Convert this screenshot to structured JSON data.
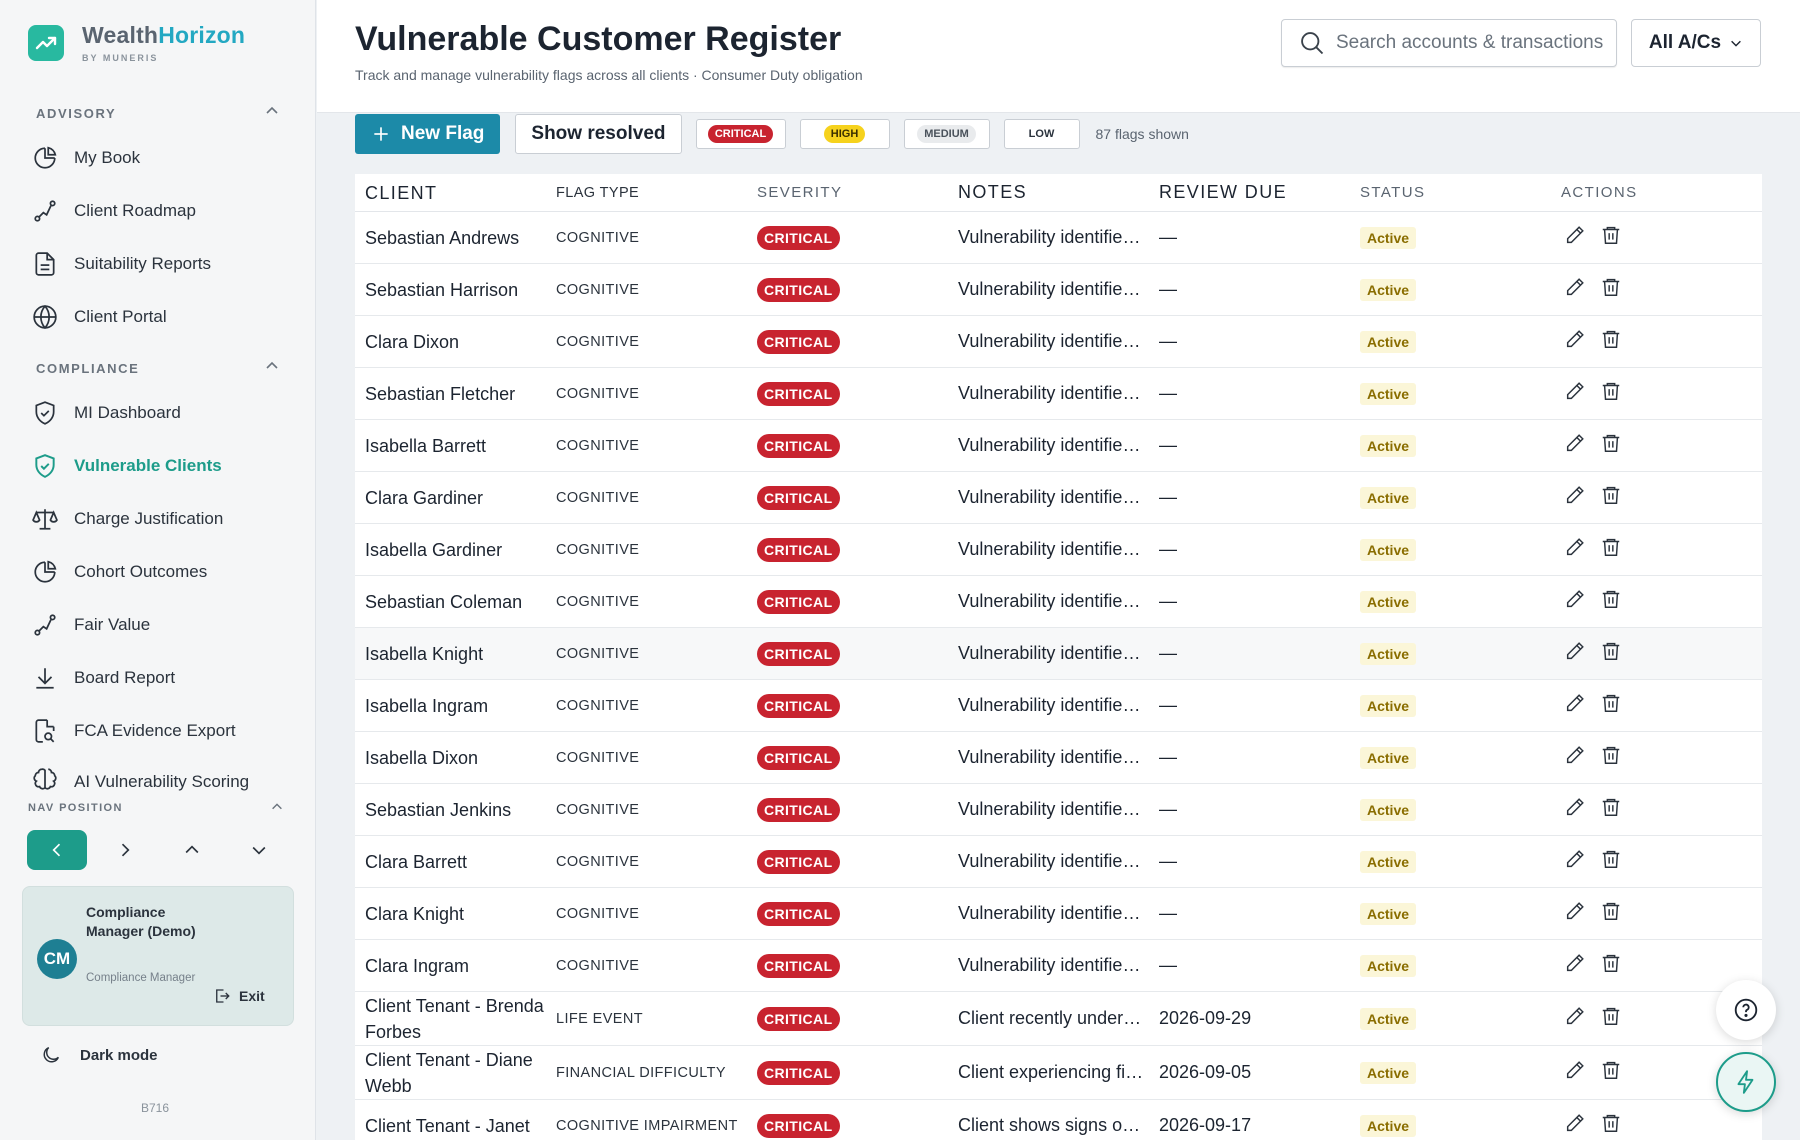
{
  "brand": {
    "name_part1": "Wealth",
    "name_part2": "Horizon",
    "tagline": "BY MUNERIS",
    "accent": "#1d9c8a"
  },
  "sidebar": {
    "advisory_label": "ADVISORY",
    "advisory_items": [
      {
        "label": "My Book",
        "icon": "pie-chart-icon"
      },
      {
        "label": "Client Roadmap",
        "icon": "route-icon"
      },
      {
        "label": "Suitability Reports",
        "icon": "document-icon"
      },
      {
        "label": "Client Portal",
        "icon": "globe-icon"
      }
    ],
    "compliance_label": "COMPLIANCE",
    "compliance_items": [
      {
        "label": "MI Dashboard",
        "icon": "shield-check-icon"
      },
      {
        "label": "Vulnerable Clients",
        "icon": "shield-check-icon",
        "active": true
      },
      {
        "label": "Charge Justification",
        "icon": "scale-icon"
      },
      {
        "label": "Cohort Outcomes",
        "icon": "pie-chart-icon"
      },
      {
        "label": "Fair Value",
        "icon": "route-icon"
      },
      {
        "label": "Board Report",
        "icon": "download-icon"
      },
      {
        "label": "FCA Evidence Export",
        "icon": "file-search-icon"
      },
      {
        "label": "AI Vulnerability Scoring",
        "icon": "brain-icon"
      }
    ],
    "nav_position_label": "NAV POSITION",
    "user": {
      "initials": "CM",
      "name": "Compliance Manager (Demo)",
      "role": "Compliance Manager",
      "exit_label": "Exit"
    },
    "dark_mode_label": "Dark mode",
    "build": "B716"
  },
  "header": {
    "title": "Vulnerable Customer Register",
    "subtitle": "Track and manage vulnerability flags across all clients · Consumer Duty obligation",
    "search_placeholder": "Search accounts & transactions",
    "account_select": "All A/Cs"
  },
  "toolbar": {
    "new_flag_label": "New Flag",
    "show_resolved_label": "Show resolved",
    "filters": [
      "CRITICAL",
      "HIGH",
      "MEDIUM",
      "LOW"
    ],
    "flags_count": "87 flags shown"
  },
  "table": {
    "columns": [
      "CLIENT",
      "FLAG TYPE",
      "SEVERITY",
      "NOTES",
      "REVIEW DUE",
      "STATUS",
      "ACTIONS"
    ],
    "rows": [
      {
        "client": "Sebastian Andrews",
        "type": "COGNITIVE",
        "severity": "CRITICAL",
        "notes": "Vulnerability identified during review",
        "due": "—",
        "status": "Active"
      },
      {
        "client": "Sebastian Harrison",
        "type": "COGNITIVE",
        "severity": "CRITICAL",
        "notes": "Vulnerability identified during review",
        "due": "—",
        "status": "Active"
      },
      {
        "client": "Clara Dixon",
        "type": "COGNITIVE",
        "severity": "CRITICAL",
        "notes": "Vulnerability identified during review",
        "due": "—",
        "status": "Active"
      },
      {
        "client": "Sebastian Fletcher",
        "type": "COGNITIVE",
        "severity": "CRITICAL",
        "notes": "Vulnerability identified during review",
        "due": "—",
        "status": "Active"
      },
      {
        "client": "Isabella Barrett",
        "type": "COGNITIVE",
        "severity": "CRITICAL",
        "notes": "Vulnerability identified during review",
        "due": "—",
        "status": "Active"
      },
      {
        "client": "Clara Gardiner",
        "type": "COGNITIVE",
        "severity": "CRITICAL",
        "notes": "Vulnerability identified during review",
        "due": "—",
        "status": "Active"
      },
      {
        "client": "Isabella Gardiner",
        "type": "COGNITIVE",
        "severity": "CRITICAL",
        "notes": "Vulnerability identified during review",
        "due": "—",
        "status": "Active"
      },
      {
        "client": "Sebastian Coleman",
        "type": "COGNITIVE",
        "severity": "CRITICAL",
        "notes": "Vulnerability identified during review",
        "due": "—",
        "status": "Active"
      },
      {
        "client": "Isabella Knight",
        "type": "COGNITIVE",
        "severity": "CRITICAL",
        "notes": "Vulnerability identified during review",
        "due": "—",
        "status": "Active",
        "hover": true
      },
      {
        "client": "Isabella Ingram",
        "type": "COGNITIVE",
        "severity": "CRITICAL",
        "notes": "Vulnerability identified during review",
        "due": "—",
        "status": "Active"
      },
      {
        "client": "Isabella Dixon",
        "type": "COGNITIVE",
        "severity": "CRITICAL",
        "notes": "Vulnerability identified during review",
        "due": "—",
        "status": "Active"
      },
      {
        "client": "Sebastian Jenkins",
        "type": "COGNITIVE",
        "severity": "CRITICAL",
        "notes": "Vulnerability identified during review",
        "due": "—",
        "status": "Active"
      },
      {
        "client": "Clara Barrett",
        "type": "COGNITIVE",
        "severity": "CRITICAL",
        "notes": "Vulnerability identified during review",
        "due": "—",
        "status": "Active"
      },
      {
        "client": "Clara Knight",
        "type": "COGNITIVE",
        "severity": "CRITICAL",
        "notes": "Vulnerability identified during review",
        "due": "—",
        "status": "Active"
      },
      {
        "client": "Clara Ingram",
        "type": "COGNITIVE",
        "severity": "CRITICAL",
        "notes": "Vulnerability identified during review",
        "due": "—",
        "status": "Active"
      },
      {
        "client": "Client Tenant - Brenda Forbes",
        "type": "LIFE EVENT",
        "severity": "CRITICAL",
        "notes": "Client recently underwent a major life event",
        "due": "2026-09-29",
        "status": "Active"
      },
      {
        "client": "Client Tenant - Diane Webb",
        "type": "FINANCIAL DIFFICULTY",
        "severity": "CRITICAL",
        "notes": "Client experiencing financial difficulty",
        "due": "2026-09-05",
        "status": "Active"
      },
      {
        "client": "Client Tenant - Janet",
        "type": "COGNITIVE IMPAIRMENT",
        "severity": "CRITICAL",
        "notes": "Client shows signs of cognitive impairment",
        "due": "2026-09-17",
        "status": "Active"
      }
    ]
  }
}
